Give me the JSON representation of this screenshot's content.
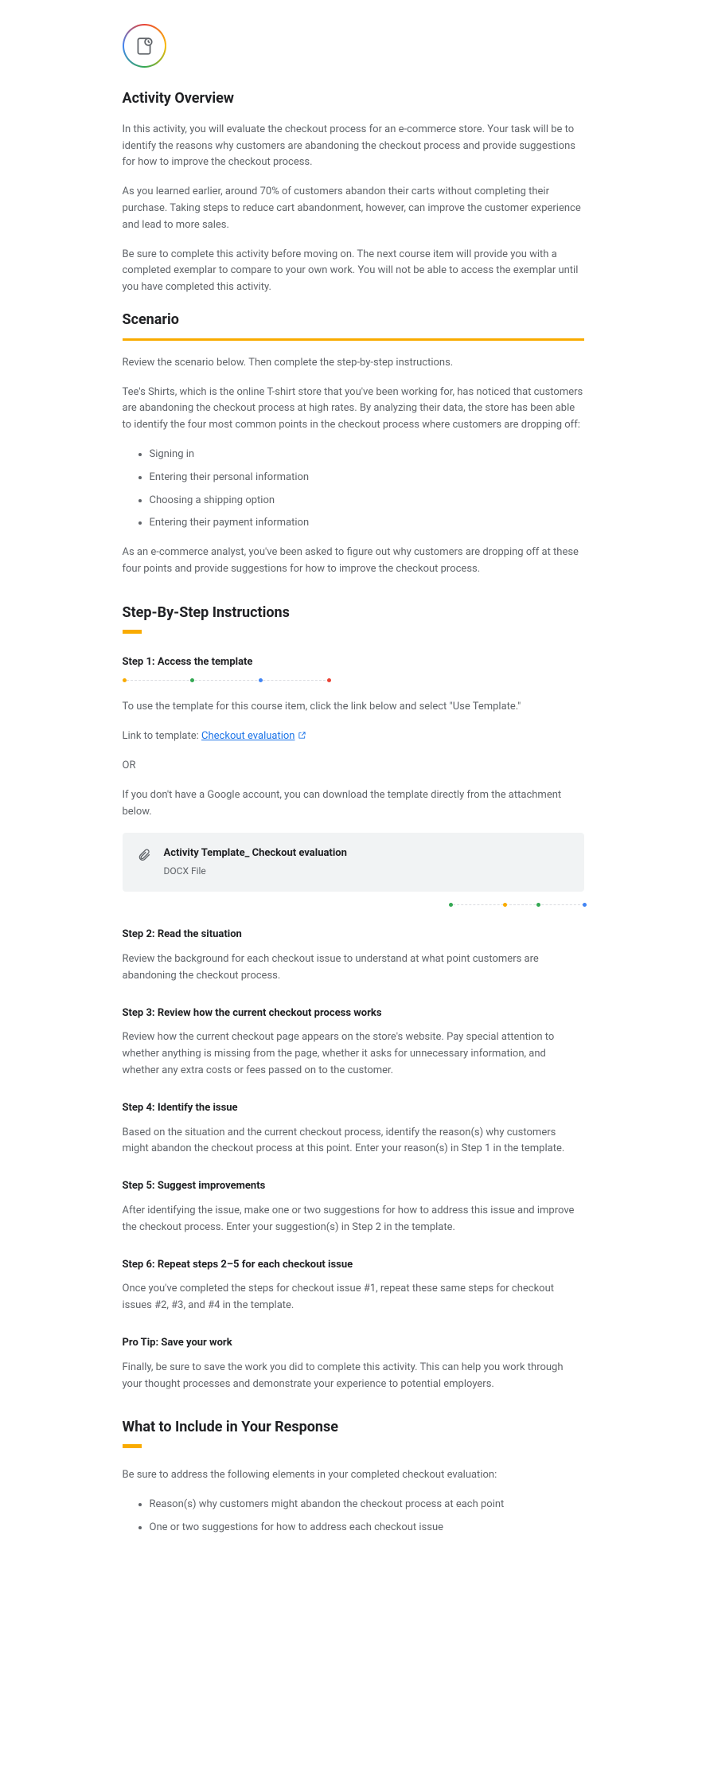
{
  "overview": {
    "heading": "Activity Overview",
    "p1": "In this activity, you will evaluate the checkout process for an e-commerce store. Your task will be to identify the reasons why customers are abandoning the checkout process and provide suggestions for how to improve the checkout process.",
    "p2": "As you learned earlier, around 70% of customers abandon their carts without completing their purchase. Taking steps to reduce cart abandonment, however, can improve the customer experience and lead to more sales.",
    "p3": "Be sure to complete this activity before moving on. The next course item will provide you with a completed exemplar to compare to your own work. You will not be able to access the exemplar until you have completed this activity."
  },
  "scenario": {
    "heading": "Scenario",
    "intro": "Review the scenario below. Then complete the step-by-step instructions.",
    "p1": "Tee's Shirts, which is the online T-shirt store that you've been working for, has noticed that customers are abandoning the checkout process at high rates. By analyzing their data, the store has been able to identify the four most common points in the checkout process where customers are dropping off:",
    "points": [
      "Signing in",
      "Entering their personal information",
      "Choosing a shipping option",
      "Entering their payment information"
    ],
    "p2": "As an e-commerce analyst, you've been asked to figure out why customers are dropping off at these four points and provide suggestions for how to improve the checkout process."
  },
  "steps": {
    "heading": "Step-By-Step Instructions",
    "s1": {
      "title": "Step 1: Access the template",
      "p1": "To use the template for this course item, click the link below and select \"Use Template.\"",
      "linkprefix": "Link to template: ",
      "linktext": "Checkout evaluation",
      "or": "OR",
      "p2": "If you don't have a Google account, you can download the template directly from the attachment below.",
      "att_title": "Activity Template_ Checkout evaluation",
      "att_sub": "DOCX File"
    },
    "s2": {
      "title": "Step 2: Read the situation",
      "p": "Review the background for each checkout issue to understand at what point customers are abandoning the checkout process."
    },
    "s3": {
      "title": "Step 3: Review how the current checkout process works",
      "p": "Review how the current checkout page appears on the store's website. Pay special attention to whether anything is missing from the page, whether it asks for unnecessary information, and whether any extra costs or fees passed on to the customer."
    },
    "s4": {
      "title": "Step 4: Identify the issue",
      "p": "Based on the situation and the current checkout process, identify the reason(s) why customers might abandon the checkout process at this point. Enter your reason(s) in Step 1 in the template."
    },
    "s5": {
      "title": "Step 5: Suggest improvements",
      "p": "After identifying the issue, make one or two suggestions for how to address this issue and improve the checkout process. Enter your suggestion(s) in Step 2 in the template."
    },
    "s6": {
      "title": "Step 6: Repeat steps 2–5 for each checkout issue",
      "p": "Once you've completed the steps for checkout issue #1, repeat these same steps for checkout issues #2, #3, and #4 in the template."
    },
    "tip": {
      "title": "Pro Tip: Save your work",
      "p": "Finally, be sure to save the work you did to complete this activity. This can help you work through your thought processes and demonstrate your experience to potential employers."
    }
  },
  "include": {
    "heading": "What to Include in Your Response",
    "intro": "Be sure to address the following elements in your completed checkout evaluation:",
    "items": [
      "Reason(s) why customers might abandon the checkout process at each point",
      "One or two suggestions for how to address each checkout issue"
    ]
  }
}
